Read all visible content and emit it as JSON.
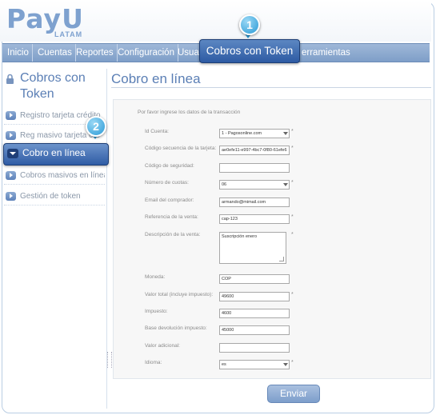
{
  "logo": {
    "brand": "PayU",
    "sub": "LATAM"
  },
  "nav": {
    "items": [
      "Inicio",
      "Cuentas",
      "Reportes",
      "Configuración",
      "Usuar",
      "erramientas"
    ],
    "active": "Cobros con Token"
  },
  "badges": {
    "one": "1",
    "two": "2"
  },
  "sidebar": {
    "title": "Cobros con Token",
    "items": [
      "Registro tarjeta crédito",
      "Reg masivo tarjeta cré",
      "Cobro en línea",
      "Cobros masivos en línea",
      "Gestión de token"
    ]
  },
  "main": {
    "title": "Cobro en línea",
    "intro": "Por favor ingrese los datos de la transacción",
    "fields": {
      "id_cuenta": {
        "label": "Id Cuenta:",
        "value": "1 - Pagosonline.com"
      },
      "codigo_secuencia": {
        "label": "Código secuencia de la tarjeta:",
        "value": "ae0efe11-e997-4bc7-0f80-61efe6"
      },
      "codigo_seguridad": {
        "label": "Código de seguridad:",
        "value": ""
      },
      "numero_cuotas": {
        "label": "Número de cuotas:",
        "value": "06"
      },
      "email": {
        "label": "Email del comprador:",
        "value": "armando@mimail.com"
      },
      "referencia": {
        "label": "Referencia de la venta:",
        "value": "cap-123"
      },
      "descripcion": {
        "label": "Descripción de la venta:",
        "value": "Suscripción enero"
      },
      "moneda": {
        "label": "Moneda:",
        "value": "COP"
      },
      "valor_total": {
        "label": "Valor total (incluye impuesto):",
        "value": "49600"
      },
      "impuesto": {
        "label": "Impuesto:",
        "value": "4600"
      },
      "base_devolucion": {
        "label": "Base devolución impuesto:",
        "value": "45000"
      },
      "valor_adicional": {
        "label": "Valor adicional:",
        "value": ""
      },
      "idioma": {
        "label": "Idioma:",
        "value": "es"
      }
    },
    "required_mark": "*",
    "submit": "Enviar"
  }
}
